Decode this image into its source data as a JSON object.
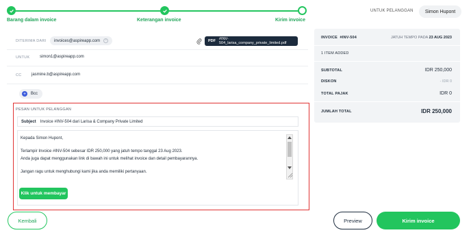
{
  "stepper": {
    "steps": [
      {
        "label": "Barang dalam invoice"
      },
      {
        "label": "Keterangan invoice"
      },
      {
        "label": "Kirim invoice"
      }
    ]
  },
  "role": {
    "label": "UNTUK PELANGGAN",
    "selected": "Simon Hupont"
  },
  "recipients": {
    "from_label": "DITERIMA DARI",
    "from_value": "invoices@aspireapp.com",
    "to_label": "UNTUK",
    "to_value": "simon1@aspireapp.com",
    "cc_label": "CC",
    "cc_value": "jasmine.b@aspireapp.com",
    "bcc_label": "Bcc"
  },
  "attachment": {
    "type": "PDF",
    "filename": "#INV-504_larisa_company_private_limited.pdf"
  },
  "message": {
    "title": "PESAN UNTUK PELANGGAN",
    "subject_label": "Subject",
    "subject_value": "Invoice #INV-504 dari Larisa & Company Private Limited",
    "lines": [
      "Kepada Simon Hupont,",
      "Terlampir Invoice #INV-504 sebesar IDR 250,000 yang jatuh tempo tanggal 23 Aug 2023.",
      " Anda juga dapat menggunakan link di bawah ini untuk melihat invoice dan detail pembayarannya.",
      "Jangan ragu untuk menghubungi kami jika anda memiliki pertanyaan."
    ],
    "pay_button": "Klik untuk membayar"
  },
  "summary": {
    "invoice_label": "INVOICE",
    "invoice_number": "#INV-504",
    "due_label": "JATUH TEMPO PADA",
    "due_date": "23 AUG 2023",
    "items_added": "1 ITEM ADDED",
    "subtotal_label": "SUBTOTAL",
    "subtotal_value": "IDR 250,000",
    "discount_label": "DISKON",
    "discount_value": "- IDR 0",
    "tax_label": "TOTAL PAJAK",
    "tax_value": "IDR 0",
    "total_label": "JUMLAH TOTAL",
    "total_value": "IDR 250,000"
  },
  "actions": {
    "back": "Kembali",
    "preview": "Preview",
    "send": "Kirim invoice"
  },
  "colors": {
    "accent": "#22c55e",
    "highlight_border": "#e03131",
    "dark": "#1c2b3d"
  }
}
